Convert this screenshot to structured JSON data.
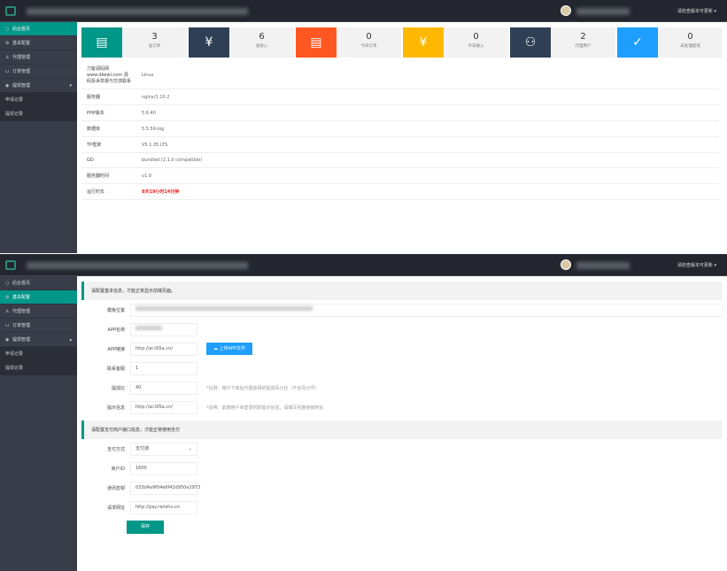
{
  "header": {
    "user": "请检查版本可更新 ▾"
  },
  "sidebar": {
    "items": [
      {
        "label": "后台首页",
        "icon": "home-icon"
      },
      {
        "label": "基本配置",
        "icon": "settings-icon"
      },
      {
        "label": "代理管理",
        "icon": "user-icon"
      },
      {
        "label": "订单管理",
        "icon": "cart-icon"
      },
      {
        "label": "提现管理",
        "icon": "money-icon"
      }
    ],
    "sub": [
      "申请记录",
      "提现记录"
    ]
  },
  "stats": [
    {
      "value": "3",
      "label": "总订单",
      "color": "#009688",
      "icon": "document-icon"
    },
    {
      "value": "6",
      "label": "总收入",
      "color": "#2f4056",
      "icon": "yen-icon"
    },
    {
      "value": "0",
      "label": "今日订单",
      "color": "#ff5722",
      "icon": "document-icon"
    },
    {
      "value": "0",
      "label": "今日收入",
      "color": "#ffb800",
      "icon": "yen-icon"
    },
    {
      "value": "2",
      "label": "代理用户",
      "color": "#2f4056",
      "icon": "users-icon"
    },
    {
      "value": "0",
      "label": "未处理提现",
      "color": "#1e9fff",
      "icon": "shield-check-icon"
    }
  ],
  "info": [
    {
      "k": "刀客源码网 www.dkewl.com 源码投诉举报与交流联系",
      "v": "Linux"
    },
    {
      "k": "服务器",
      "v": "nginx/1.10.2"
    },
    {
      "k": "PHP版本",
      "v": "5.6.40"
    },
    {
      "k": "数据库",
      "v": "5.5.59-log"
    },
    {
      "k": "TP框架",
      "v": "V5.1.35 LTS"
    },
    {
      "k": "GD",
      "v": "bundled (2.1.0 compatible)"
    },
    {
      "k": "服务器时间",
      "v": "v1.0"
    },
    {
      "k": "运行时长",
      "v": "8天19小时14分钟",
      "red": true
    }
  ],
  "config": {
    "notice1": "请配置基本信息，才能正常显示前端页面。",
    "fields1": [
      {
        "label": "模板位置",
        "value": ""
      },
      {
        "label": "APP名称",
        "value": ""
      },
      {
        "label": "APP链接",
        "value": "http://ai.t05a.cn/"
      },
      {
        "label": "联系客服",
        "value": "1"
      },
      {
        "label": "提成比",
        "value": "40",
        "hint": "*比例：用户下单后代理获得的提成百分比（不含百分号）"
      },
      {
        "label": "提示信息",
        "value": "http://ai.t05a.cn/",
        "hint": "*说明：前端用户未登录时的提示信息，请填写完整链接地址"
      }
    ],
    "upload_button": "上传APP文件",
    "notice2": "请配置支付商户接口信息，才能正常使用支付",
    "fields2": [
      {
        "label": "支付方式",
        "value": "支付通"
      },
      {
        "label": "商户ID",
        "value": "1600"
      },
      {
        "label": "通讯密钥",
        "value": "033d4a9f04e6f42d950e2973"
      },
      {
        "label": "请求网址",
        "value": "http://pay.ranzhu.cn"
      }
    ],
    "save_button": "保存"
  }
}
